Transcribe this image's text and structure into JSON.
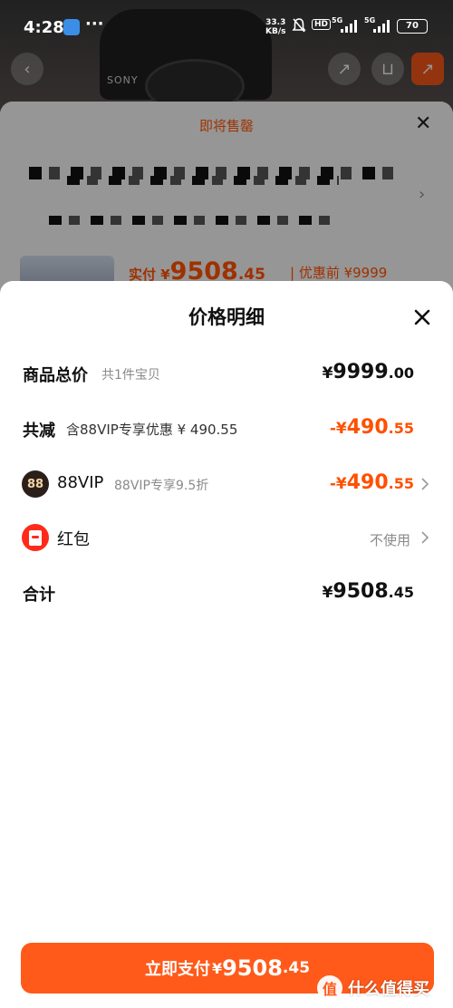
{
  "status_bar": {
    "time": "4:28",
    "more": "···",
    "speed_value": "33.3",
    "speed_unit": "KB/s",
    "hd": "HD",
    "net1": "5G",
    "net2": "5G",
    "battery": "70"
  },
  "background": {
    "camera_brand": "SONY"
  },
  "back_sheet": {
    "title": "即将售罄",
    "price_label": "实付 ¥",
    "price_int": "9508",
    "price_dec": ".45",
    "price_before": "| 优惠前 ¥9999"
  },
  "sheet": {
    "title": "价格明细",
    "rows": {
      "total": {
        "label": "商品总价",
        "sub": "共1件宝贝",
        "cur": "¥",
        "int": "9999",
        "dec": ".00"
      },
      "reduce": {
        "label": "共减",
        "sub": "含88VIP专享优惠 ¥ 490.55",
        "cur": "-¥",
        "int": "490",
        "dec": ".55"
      },
      "vip": {
        "icon": "88",
        "label": "88VIP",
        "sub": "88VIP专享9.5折",
        "cur": "-¥",
        "int": "490",
        "dec": ".55"
      },
      "redpack": {
        "label": "红包",
        "status": "不使用"
      },
      "sum": {
        "label": "合计",
        "cur": "¥",
        "int": "9508",
        "dec": ".45"
      }
    }
  },
  "pay_button": {
    "label": "立即支付",
    "cur": "¥",
    "int": "9508",
    "dec": ".45"
  },
  "watermark": {
    "badge": "值",
    "text": "什么值得买"
  },
  "colors": {
    "accent": "#ff5000",
    "button": "#ff5a1a",
    "vip_dark": "#2a1f1a",
    "redpack": "#ff2a1a"
  }
}
